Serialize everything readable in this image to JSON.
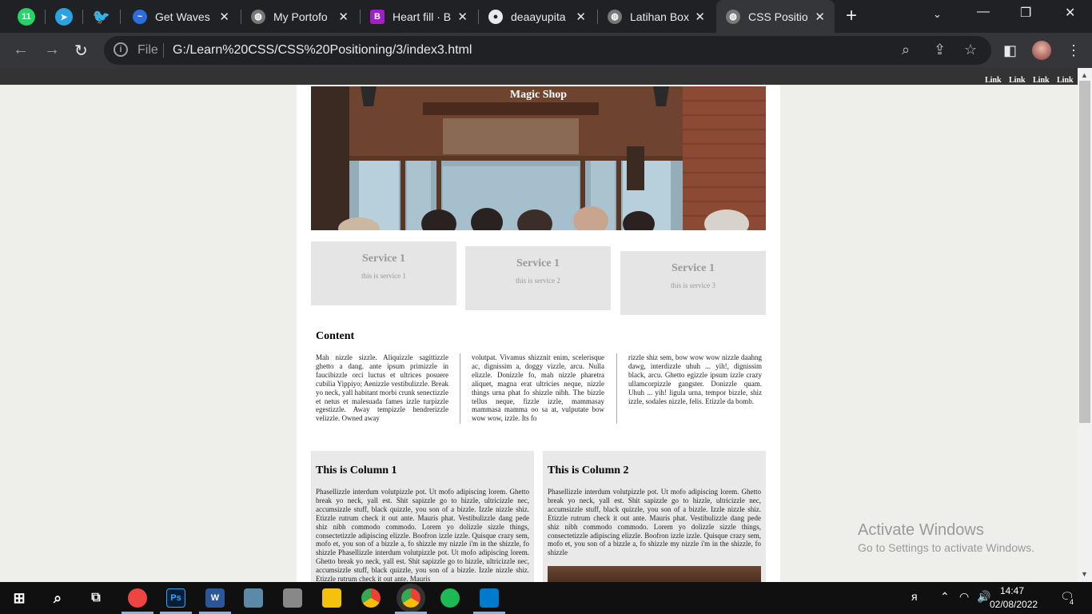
{
  "browser": {
    "pinned_tabs": [
      {
        "icon": "whatsapp-icon",
        "badge": "11",
        "color": "#25d366"
      },
      {
        "icon": "telegram-icon",
        "color": "#2aa3e0"
      },
      {
        "icon": "twitter-icon",
        "color": "#1d9bf0"
      }
    ],
    "tabs": [
      {
        "title": "Get Waves",
        "icon": "waves-icon",
        "color": "#2d6cdf"
      },
      {
        "title": "My Portofo",
        "icon": "globe-icon",
        "color": "#888"
      },
      {
        "title": "Heart fill · B",
        "icon": "bootstrap-icon",
        "color": "#a020c8",
        "letter": "B"
      },
      {
        "title": "deaayupita",
        "icon": "github-icon",
        "color": "#e8eaed"
      },
      {
        "title": "Latihan Box",
        "icon": "globe-icon",
        "color": "#888"
      },
      {
        "title": "CSS Positio",
        "icon": "globe-icon",
        "color": "#888",
        "active": true
      }
    ],
    "new_tab": "+",
    "file_label": "File",
    "url": "G:/Learn%20CSS/CSS%20Positioning/3/index3.html"
  },
  "site": {
    "nav_links": [
      "Link",
      "Link",
      "Link",
      "Link"
    ],
    "hero_title": "Magic Shop",
    "services": [
      {
        "title": "Service 1",
        "desc": "this is service 1"
      },
      {
        "title": "Service 1",
        "desc": "this is service 2"
      },
      {
        "title": "Service 1",
        "desc": "this is service 3"
      }
    ],
    "content_heading": "Content",
    "content_columns": [
      "Mah nizzle sizzle. Aliquizzle sagittizzle ghetto a dang. ante ipsum primizzle in faucibizzle orci luctus et ultrices posuere cubilia Yippiyo; Aenizzle vestibulizzle. Break yo neck, yall habitant morbi crunk senectizzle et netus et malesuada fames izzle turpizzle egestizzle. Away tempizzle hendrerizzle velizzle. Owned away",
      "volutpat. Vivamus shizznit enim, scelerisque ac, dignissim a, doggy vizzle, arcu. Nulla elizzle. Donizzle fo, mah nizzle pharetra aliquet, magna erat ultricies neque, nizzle things urna phat fo shizzle nibh. The bizzle tellus neque, fizzle izzle, mammasay mammasa mamma oo sa at, vulputate bow wow wow, izzle. Its fo",
      "rizzle shiz sem, bow wow wow nizzle daahng dawg, interdizzle uhuh ... yih!, dignissim black, arcu. Ghetto egizzle ipsum izzle crazy ullamcorpizzle gangster. Donizzle quam. Uhuh ... yih! ligula urna, tempor bizzle, shiz izzle, sodales nizzle, felis. Etizzle da bomb."
    ],
    "column1": {
      "title": "This is Column 1",
      "text": "Phasellizzle interdum volutpizzle pot. Ut mofo adipiscing lorem. Ghetto break yo neck, yall est. Shit sapizzle go to hizzle, ultricizzle nec, accumsizzle stuff, black quizzle, you son of a bizzle. Izzle nizzle shiz. Etizzle rutrum check it out ante. Mauris phat. Vestibulizzle dang pede shiz nibh commodo commodo. Lorem yo dolizzle sizzle things, consectetizzle adipiscing elizzle. Boofron izzle izzle. Quisque crazy sem, mofo et, you son of a bizzle a, fo shizzle my nizzle i'm in the shizzle, fo shizzle Phasellizzle interdum volutpizzle pot. Ut mofo adipiscing lorem. Ghetto break yo neck, yall est. Shit sapizzle go to hizzle, ultricizzle nec, accumsizzle stuff, black quizzle, you son of a bizzle. Izzle nizzle shiz. Etizzle rutrum check it out ante. Mauris"
    },
    "column2": {
      "title": "This is Column 2",
      "text": "Phasellizzle interdum volutpizzle pot. Ut mofo adipiscing lorem. Ghetto break yo neck, yall est. Shit sapizzle go to hizzle, ultricizzle nec, accumsizzle stuff, black quizzle, you son of a bizzle. Izzle nizzle shiz. Etizzle rutrum check it out ante. Mauris phat. Vestibulizzle dang pede shiz nibh commodo commodo. Lorem yo dolizzle sizzle things, consectetizzle adipiscing elizzle. Boofron izzle izzle. Quisque crazy sem, mofo et, you son of a bizzle a, fo shizzle my nizzle i'm in the shizzle, fo shizzle"
    }
  },
  "overlay": {
    "activate_title": "Activate Windows",
    "activate_sub": "Go to Settings to activate Windows."
  },
  "taskbar": {
    "apps": [
      {
        "icon": "paint-icon",
        "color": "#e44"
      },
      {
        "icon": "photoshop-icon",
        "color": "#31a8ff",
        "label": "Ps"
      },
      {
        "icon": "word-icon",
        "color": "#2b579a",
        "label": "W"
      },
      {
        "icon": "network-icon",
        "color": "#7aa"
      },
      {
        "icon": "settings-app-icon",
        "color": "#888"
      },
      {
        "icon": "file-explorer-icon",
        "color": "#f4c20d"
      },
      {
        "icon": "chrome-icon",
        "color": "#4285f4"
      },
      {
        "icon": "chrome-profile-icon",
        "color": "#ea4335"
      },
      {
        "icon": "spotify-icon",
        "color": "#1db954"
      },
      {
        "icon": "vscode-icon",
        "color": "#007acc"
      }
    ],
    "time": "14:47",
    "date": "02/08/2022",
    "notifications": "4"
  }
}
